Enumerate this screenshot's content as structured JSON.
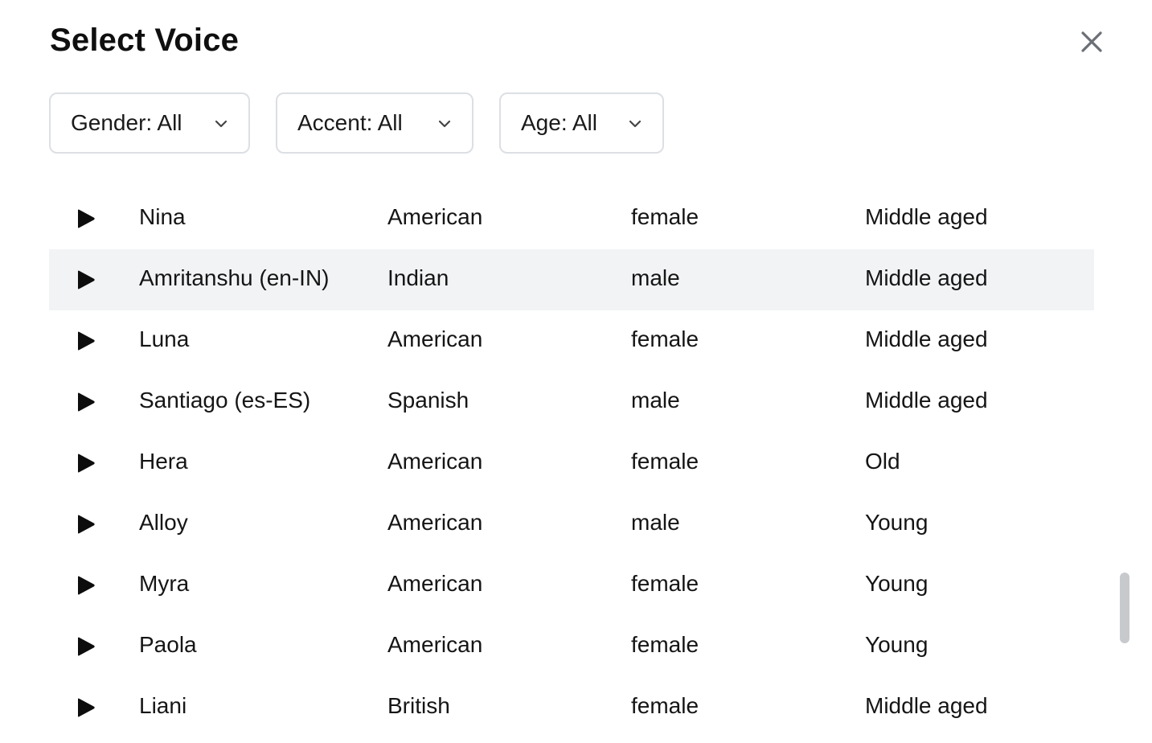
{
  "dialog": {
    "title": "Select Voice",
    "close_icon": "close-icon"
  },
  "filters": [
    {
      "label": "Gender: All",
      "icon": "chevron-down-icon"
    },
    {
      "label": "Accent: All",
      "icon": "chevron-down-icon"
    },
    {
      "label": "Age: All",
      "icon": "chevron-down-icon"
    }
  ],
  "voices": [
    {
      "name": "Nina",
      "accent": "American",
      "gender": "female",
      "age": "Middle aged"
    },
    {
      "name": "Amritanshu (en-IN)",
      "accent": "Indian",
      "gender": "male",
      "age": "Middle aged"
    },
    {
      "name": "Luna",
      "accent": "American",
      "gender": "female",
      "age": "Middle aged"
    },
    {
      "name": "Santiago (es-ES)",
      "accent": "Spanish",
      "gender": "male",
      "age": "Middle aged"
    },
    {
      "name": "Hera",
      "accent": "American",
      "gender": "female",
      "age": "Old"
    },
    {
      "name": "Alloy",
      "accent": "American",
      "gender": "male",
      "age": "Young"
    },
    {
      "name": "Myra",
      "accent": "American",
      "gender": "female",
      "age": "Young"
    },
    {
      "name": "Paola",
      "accent": "American",
      "gender": "female",
      "age": "Young"
    },
    {
      "name": "Liani",
      "accent": "British",
      "gender": "female",
      "age": "Middle aged"
    }
  ],
  "colors": {
    "hover_row": "#f2f3f5",
    "border": "#dcdfe4",
    "scrollbar": "#c7c9cd"
  }
}
